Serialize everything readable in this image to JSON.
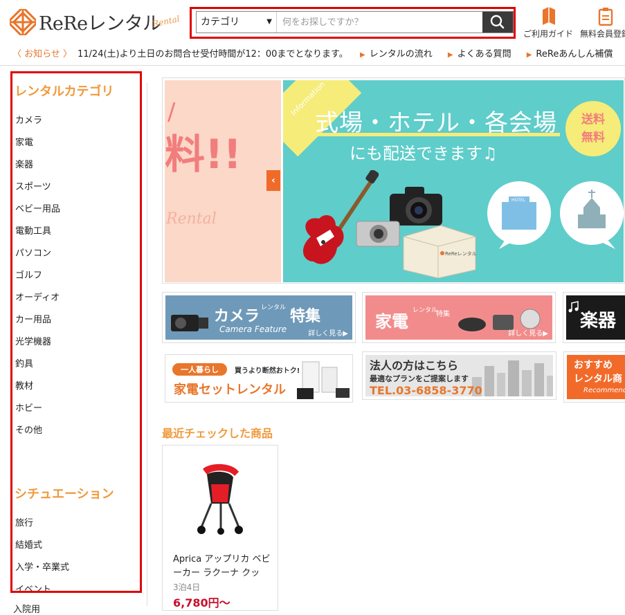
{
  "header": {
    "logo_text": "ReReレンタル",
    "logo_script": "Rental",
    "search": {
      "category_label": "カテゴリ",
      "placeholder": "何をお探しですか？"
    },
    "links": [
      {
        "label": "ご利用ガイド",
        "icon": "guide-icon"
      },
      {
        "label": "無料会員登録",
        "icon": "clipboard-icon"
      }
    ]
  },
  "notice": {
    "tag": "〈 お知らせ 〉",
    "text": "11/24(土)より土日のお問合せ受付時間が12：00までとなります。",
    "links": [
      "レンタルの流れ",
      "よくある質問",
      "ReReあんしん補償"
    ]
  },
  "sidebar": {
    "category_heading": "レンタルカテゴリ",
    "categories": [
      "カメラ",
      "家電",
      "楽器",
      "スポーツ",
      "ベビー用品",
      "電動工具",
      "パソコン",
      "ゴルフ",
      "オーディオ",
      "カー用品",
      "光学機器",
      "釣具",
      "教材",
      "ホビー",
      "その他"
    ],
    "situation_heading": "シチュエーション",
    "situations": [
      "旅行",
      "結婚式",
      "入学・卒業式",
      "イベント",
      "入院用"
    ]
  },
  "banner": {
    "left_text": "料!!",
    "left_script": "Rental",
    "info_tag": "Information",
    "title": "式場・ホテル・各会場",
    "subtitle": "にも配送できます♫",
    "free_badge": [
      "送料",
      "無料"
    ],
    "box_label": "ReReレンタル",
    "hotel_label": "HOTEL"
  },
  "tiles": {
    "camera": {
      "title": "カメラ",
      "mini": "レンタル",
      "title2": "特集",
      "sub": "Camera Feature",
      "more": "詳しく見る▶"
    },
    "appliance": {
      "title": "家電",
      "mini": "レンタル",
      "title2": "特集",
      "more": "詳しく見る▶"
    },
    "instrument": {
      "title": "楽器"
    },
    "set": {
      "badge": "一人暮らし",
      "tagline": "買うより断然おトク!",
      "title": "家電セットレンタル"
    },
    "corporate": {
      "title": "法人の方はこちら",
      "sub": "最適なプランをご提案します",
      "tel": "TEL.03-6858-3770"
    },
    "recommend": {
      "line1": "おすすめ",
      "line2": "レンタル商",
      "script": "Recommend!"
    }
  },
  "recent": {
    "heading": "最近チェックした商品",
    "product": {
      "name": "Aprica アップリカ ベビーカー ラクーナ クッ",
      "duration": "3泊4日",
      "price": "6,780円〜"
    }
  },
  "colors": {
    "accent": "#f0993b",
    "highlight": "#e00000",
    "price": "#c8102e",
    "banner_teal": "#5fcdca"
  }
}
